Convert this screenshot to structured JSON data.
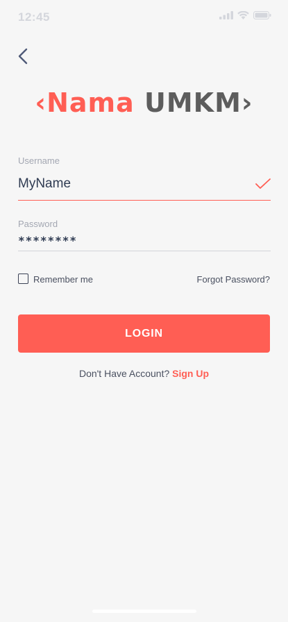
{
  "status_bar": {
    "time": "12:45"
  },
  "logo": {
    "left_bracket": "‹",
    "name": "Nama",
    "brand": "UMKM",
    "right_bracket": "›"
  },
  "form": {
    "username_label": "Username",
    "username_value": "MyName",
    "password_label": "Password",
    "password_value": "********",
    "remember_label": "Remember me",
    "remember_checked": false,
    "forgot_label": "Forgot Password?",
    "login_label": "LOGIN"
  },
  "signup": {
    "prompt": "Don't Have Account?",
    "link": "Sign Up"
  },
  "icons": {
    "back": "chevron-left-icon",
    "signal": "cellular-signal-icon",
    "wifi": "wifi-icon",
    "battery": "battery-icon",
    "valid": "checkmark-icon"
  },
  "colors": {
    "accent": "#ff5e54",
    "logo_dark": "#5d5d5d",
    "background": "#f6f6f6",
    "text": "#2f3b52"
  }
}
